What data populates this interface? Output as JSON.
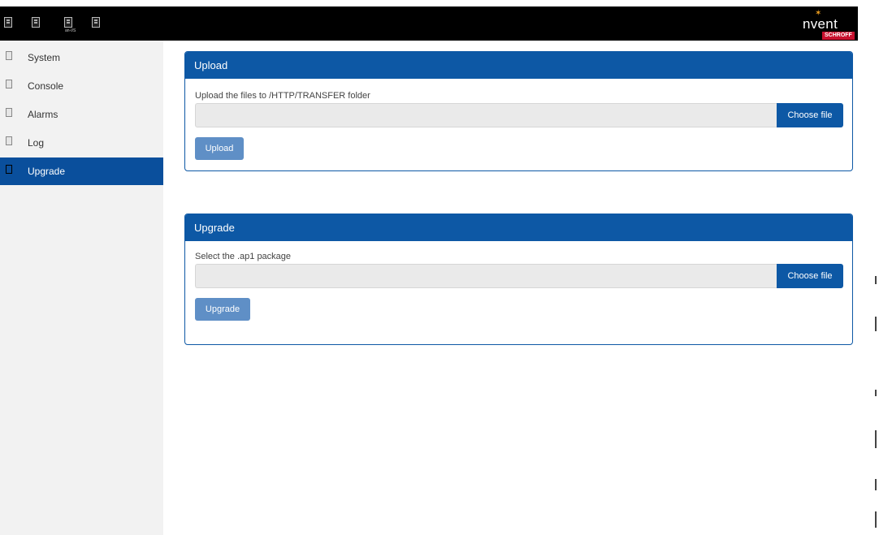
{
  "header": {
    "icons": [
      "device-icon",
      "device-icon",
      "device-icon",
      "device-icon"
    ],
    "icon_caption": "an-I/S",
    "brand": "nvent",
    "brand_sub": "SCHROFF"
  },
  "sidebar": {
    "items": [
      {
        "label": "System",
        "icon": "device-icon",
        "active": false
      },
      {
        "label": "Console",
        "icon": "device-icon",
        "active": false
      },
      {
        "label": "Alarms",
        "icon": "device-icon",
        "active": false
      },
      {
        "label": "Log",
        "icon": "device-icon",
        "active": false
      },
      {
        "label": "Upgrade",
        "icon": "device-icon",
        "active": true
      }
    ]
  },
  "upload_panel": {
    "title": "Upload",
    "description": "Upload the files to /HTTP/TRANSFER folder",
    "choose_label": "Choose file",
    "button_label": "Upload"
  },
  "upgrade_panel": {
    "title": "Upgrade",
    "description": "Select the .ap1 package",
    "choose_label": "Choose file",
    "button_label": "Upgrade"
  },
  "colors": {
    "primary": "#0d58a5",
    "button_disabled": "#5f8fc6",
    "sidebar_bg": "#f2f2f2",
    "topbar_bg": "#000000",
    "brand_accent": "#c8102e"
  }
}
